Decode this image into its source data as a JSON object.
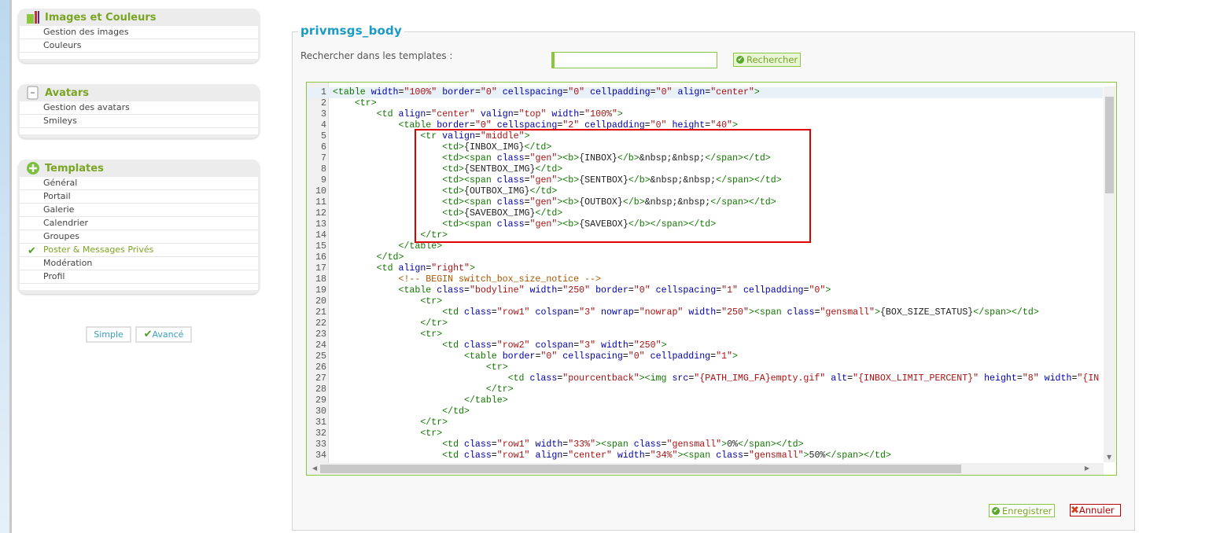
{
  "sidebar": {
    "sections": [
      {
        "title": "Images et Couleurs",
        "icon": "palette-icon",
        "items": [
          "Gestion des images",
          "Couleurs"
        ]
      },
      {
        "title": "Avatars",
        "icon": "avatar-icon",
        "items": [
          "Gestion des avatars",
          "Smileys"
        ]
      },
      {
        "title": "Templates",
        "icon": "plus-circle-icon",
        "items": [
          "Général",
          "Portail",
          "Galerie",
          "Calendrier",
          "Groupes",
          "Poster & Messages Privés",
          "Modération",
          "Profil"
        ],
        "selected": 5
      }
    ],
    "mode_buttons": {
      "simple": "Simple",
      "advanced": "Avancé"
    }
  },
  "main": {
    "title": "privmsgs_body",
    "search_label": "Rechercher dans les templates :",
    "search_value": "",
    "search_button": "Rechercher",
    "save_button": "Enregistrer",
    "cancel_button": "Annuler",
    "code_lines": [
      "<table width=\"100%\" border=\"0\" cellspacing=\"0\" cellpadding=\"0\" align=\"center\">",
      "    <tr>",
      "        <td align=\"center\" valign=\"top\" width=\"100%\">",
      "            <table border=\"0\" cellspacing=\"2\" cellpadding=\"0\" height=\"40\">",
      "                <tr valign=\"middle\">",
      "                    <td>{INBOX_IMG}</td>",
      "                    <td><span class=\"gen\"><b>{INBOX}</b>&nbsp;&nbsp;</span></td>",
      "                    <td>{SENTBOX_IMG}</td>",
      "                    <td><span class=\"gen\"><b>{SENTBOX}</b>&nbsp;&nbsp;</span></td>",
      "                    <td>{OUTBOX_IMG}</td>",
      "                    <td><span class=\"gen\"><b>{OUTBOX}</b>&nbsp;&nbsp;</span></td>",
      "                    <td>{SAVEBOX_IMG}</td>",
      "                    <td><span class=\"gen\"><b>{SAVEBOX}</b></span></td>",
      "                </tr>",
      "            </table>",
      "        </td>",
      "        <td align=\"right\">",
      "            <!-- BEGIN switch_box_size_notice -->",
      "            <table class=\"bodyline\" width=\"250\" border=\"0\" cellspacing=\"1\" cellpadding=\"0\">",
      "                <tr>",
      "                    <td class=\"row1\" colspan=\"3\" nowrap=\"nowrap\" width=\"250\"><span class=\"gensmall\">{BOX_SIZE_STATUS}</span></td>",
      "                </tr>",
      "                <tr>",
      "                    <td class=\"row2\" colspan=\"3\" width=\"250\">",
      "                        <table border=\"0\" cellspacing=\"0\" cellpadding=\"1\">",
      "                            <tr>",
      "                                <td class=\"pourcentback\"><img src=\"{PATH_IMG_FA}empty.gif\" alt=\"{INBOX_LIMIT_PERCENT}\" height=\"8\" width=\"{IN",
      "                            </tr>",
      "                        </table>",
      "                    </td>",
      "                </tr>",
      "                <tr>",
      "                    <td class=\"row1\" width=\"33%\"><span class=\"gensmall\">0%</span></td>",
      "                    <td class=\"row1\" align=\"center\" width=\"34%\"><span class=\"gensmall\">50%</span></td>"
    ]
  }
}
